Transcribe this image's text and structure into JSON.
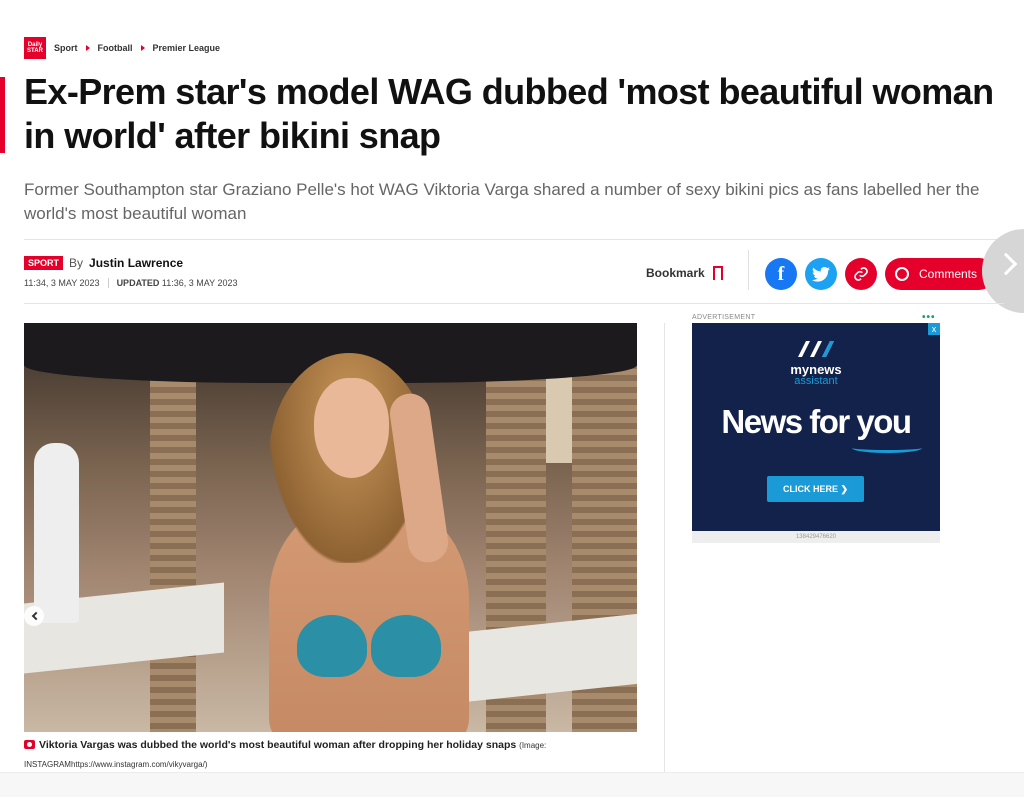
{
  "breadcrumb": {
    "logo_text": "Daily STAR",
    "items": [
      "Sport",
      "Football",
      "Premier League"
    ]
  },
  "article": {
    "headline": "Ex-Prem star's model WAG dubbed 'most beautiful woman in world' after bikini snap",
    "standfirst": "Former Southampton star Graziano Pelle's hot WAG Viktoria Varga shared a number of sexy bikini pics as fans labelled her the world's most beautiful woman",
    "section_tag": "SPORT",
    "by_label": "By",
    "author": "Justin Lawrence",
    "published": "11:34, 3 MAY 2023",
    "updated_label": "UPDATED",
    "updated": "11:36, 3 MAY 2023"
  },
  "actions": {
    "bookmark_label": "Bookmark",
    "comments_label": "Comments",
    "facebook_glyph": "f",
    "twitter_glyph": "t",
    "link_glyph": "🔗"
  },
  "image": {
    "caption": "Viktoria Vargas was dubbed the world's most beautiful woman after dropping her holiday snaps",
    "credit": "(Image: INSTAGRAMhttps://www.instagram.com/vikyvarga/)"
  },
  "ad": {
    "label": "ADVERTISEMENT",
    "dots": "•••",
    "close": "x",
    "brand_line1": "mynews",
    "brand_line2": "assistant",
    "headline": "News for you",
    "cta": "CLICK HERE ❯",
    "id": "138429476620"
  },
  "colors": {
    "brand_red": "#e4002b",
    "facebook": "#1877f2",
    "twitter": "#1da1f2",
    "ad_bg": "#13224a",
    "ad_accent": "#1a9bd8"
  },
  "icons": [
    "daily-star-logo",
    "chevron-right-icon",
    "bookmark-icon",
    "facebook-icon",
    "twitter-icon",
    "link-icon",
    "comment-icon",
    "camera-icon",
    "prev-arrow-icon",
    "next-arrow-icon",
    "ad-close-icon"
  ]
}
